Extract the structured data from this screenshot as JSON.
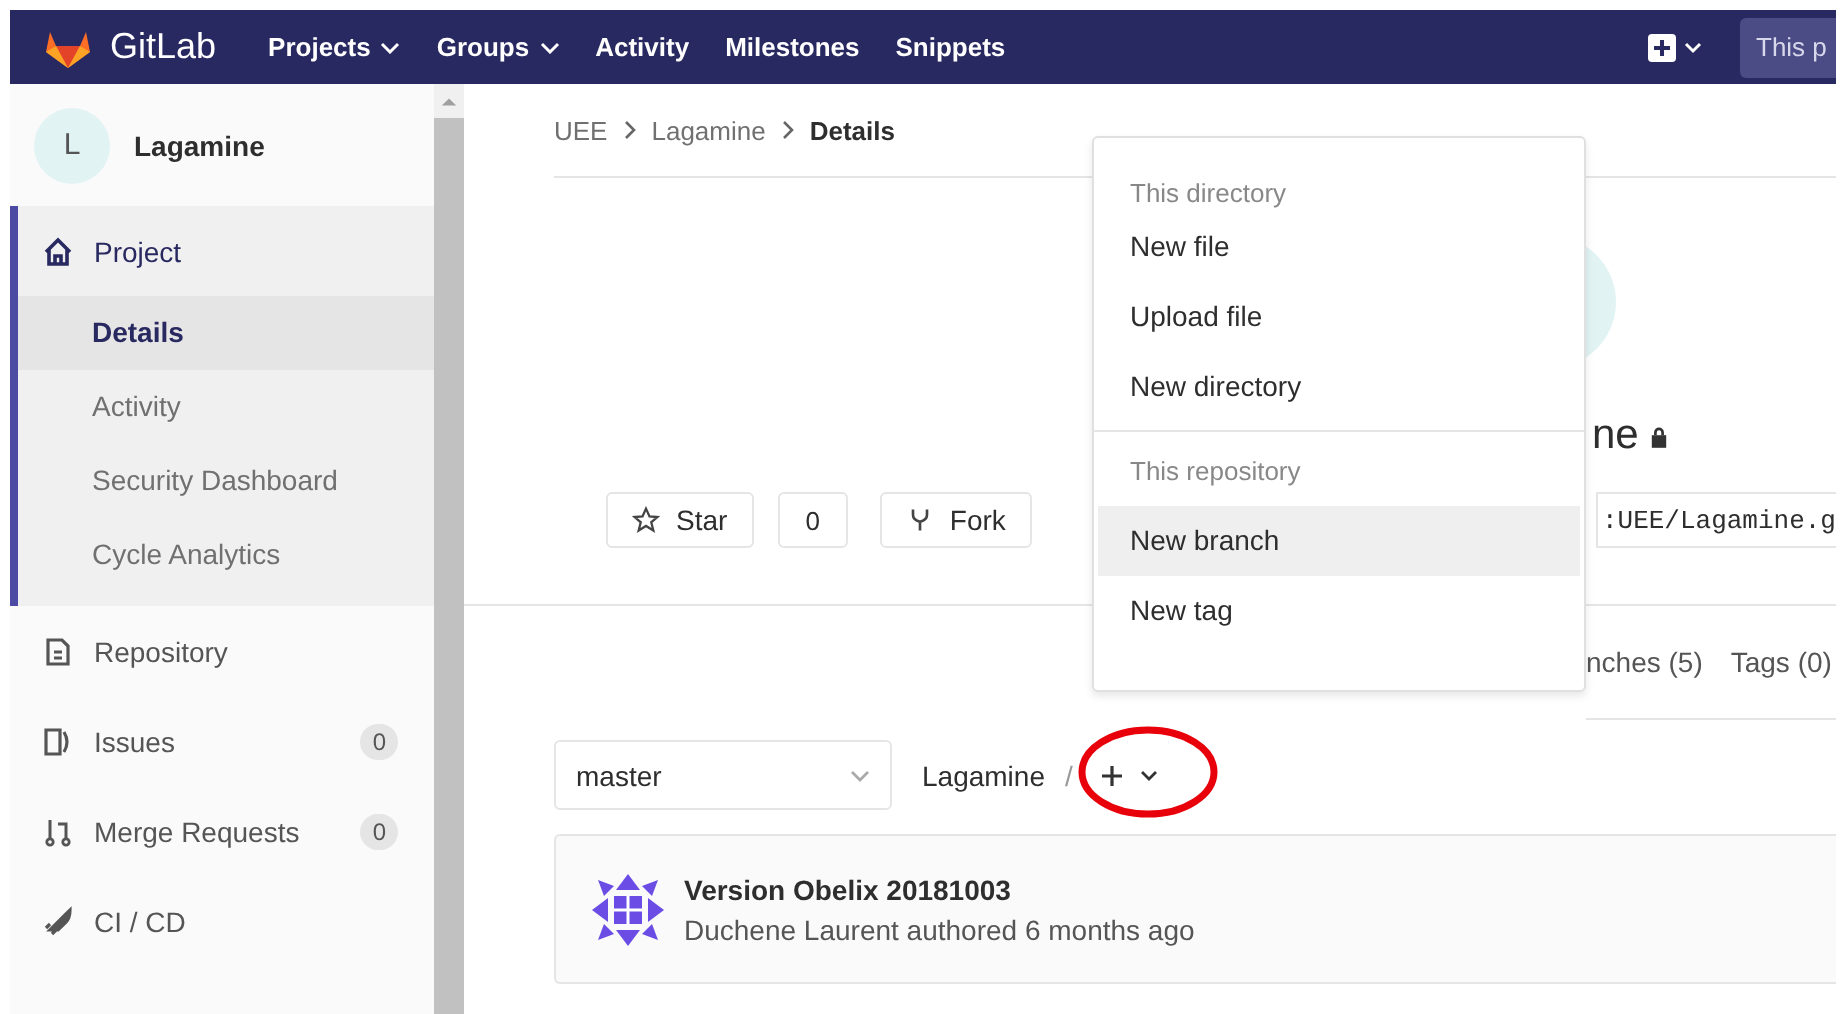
{
  "topbar": {
    "logo_text": "GitLab",
    "nav": [
      {
        "label": "Projects",
        "dropdown": true
      },
      {
        "label": "Groups",
        "dropdown": true
      },
      {
        "label": "Activity",
        "dropdown": false
      },
      {
        "label": "Milestones",
        "dropdown": false
      },
      {
        "label": "Snippets",
        "dropdown": false
      }
    ],
    "search": {
      "placeholder": "This p"
    }
  },
  "sidebar": {
    "project": {
      "initial": "L",
      "name": "Lagamine"
    },
    "items": [
      {
        "label": "Project",
        "selected": true,
        "children": [
          {
            "label": "Details",
            "selected": true
          },
          {
            "label": "Activity",
            "selected": false
          },
          {
            "label": "Security Dashboard",
            "selected": false
          },
          {
            "label": "Cycle Analytics",
            "selected": false
          }
        ]
      },
      {
        "label": "Repository",
        "selected": false
      },
      {
        "label": "Issues",
        "selected": false,
        "count": "0"
      },
      {
        "label": "Merge Requests",
        "selected": false,
        "count": "0"
      },
      {
        "label": "CI / CD",
        "selected": false
      }
    ]
  },
  "breadcrumb": [
    {
      "label": "UEE",
      "current": false
    },
    {
      "label": "Lagamine",
      "current": false
    },
    {
      "label": "Details",
      "current": true
    }
  ],
  "project": {
    "title": "ne",
    "private": true
  },
  "buttons": [
    {
      "label": "Star",
      "count": "0"
    },
    {
      "label": "Fork"
    }
  ],
  "clone_url": ":UEE/Lagamine.g",
  "stats": [
    "nches (5)",
    "Tags (0)"
  ],
  "tree": {
    "branch": "master",
    "path": "Lagamine",
    "separator": "/"
  },
  "add_menu": {
    "sections": [
      {
        "header": "This directory",
        "items": [
          {
            "label": "New file",
            "selected": false
          },
          {
            "label": "Upload file",
            "selected": false
          },
          {
            "label": "New directory",
            "selected": false
          }
        ]
      },
      {
        "header": "This repository",
        "items": [
          {
            "label": "New branch",
            "selected": true
          },
          {
            "label": "New tag",
            "selected": false
          }
        ]
      }
    ]
  },
  "commit": {
    "title": "Version Obelix 20181003",
    "byline": "Duchene Laurent authored 6 months ago"
  }
}
